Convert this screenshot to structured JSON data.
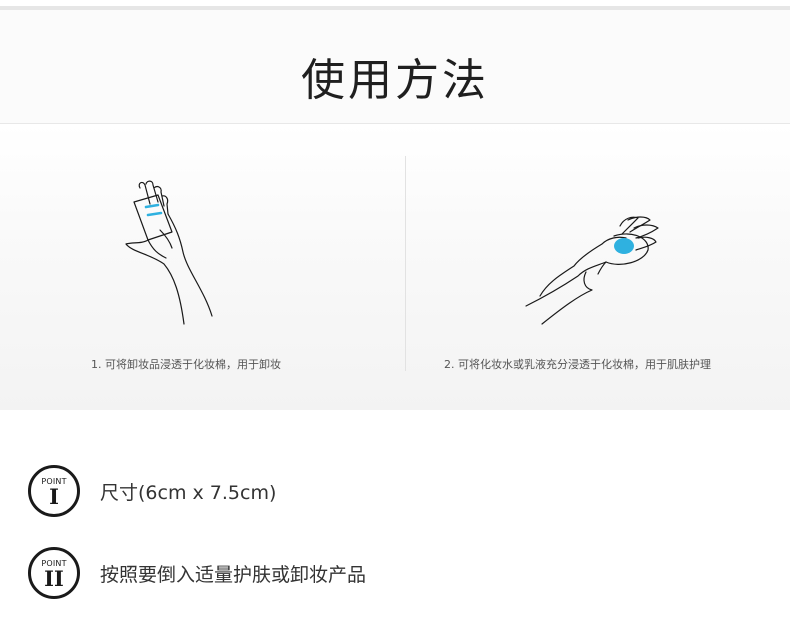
{
  "header": {
    "title": "使用方法"
  },
  "steps": [
    {
      "caption": "1. 可将卸妆品浸透于化妆棉，用于卸妆"
    },
    {
      "caption": "2. 可将化妆水或乳液充分浸透于化妆棉，用于肌肤护理"
    }
  ],
  "points": [
    {
      "badge_word": "POINT",
      "badge_number": "I",
      "text": "尺寸(6cm x 7.5cm)"
    },
    {
      "badge_word": "POINT",
      "badge_number": "II",
      "text": "按照要倒入适量护肤或卸妆产品"
    }
  ],
  "colors": {
    "accent": "#2fb1e0",
    "text": "#333333",
    "line": "#1a1a1a"
  }
}
